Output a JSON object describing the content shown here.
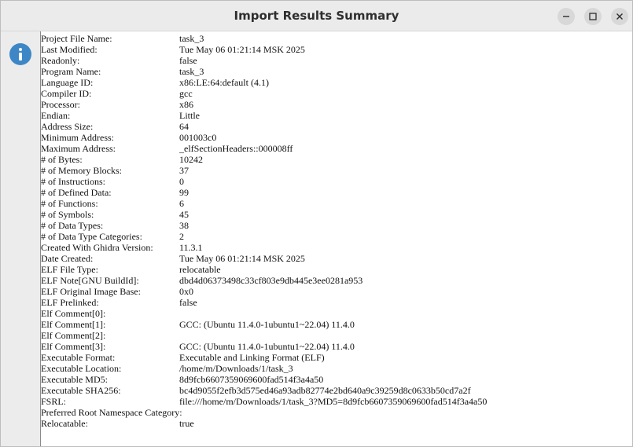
{
  "window": {
    "title": "Import Results Summary"
  },
  "icons": {
    "info": "info-icon",
    "minimize": "minimize-icon",
    "maximize": "maximize-icon",
    "close": "close-icon"
  },
  "rows": [
    {
      "label": "Project File Name:",
      "value": "task_3"
    },
    {
      "label": "Last Modified:",
      "value": "Tue May 06 01:21:14 MSK 2025"
    },
    {
      "label": "Readonly:",
      "value": "false"
    },
    {
      "label": "Program Name:",
      "value": "task_3"
    },
    {
      "label": "Language ID:",
      "value": "x86:LE:64:default (4.1)"
    },
    {
      "label": "Compiler ID:",
      "value": "gcc"
    },
    {
      "label": "Processor:",
      "value": "x86"
    },
    {
      "label": "Endian:",
      "value": "Little"
    },
    {
      "label": "Address Size:",
      "value": "64"
    },
    {
      "label": "Minimum Address:",
      "value": "001003c0"
    },
    {
      "label": "Maximum Address:",
      "value": "_elfSectionHeaders::000008ff"
    },
    {
      "label": "# of Bytes:",
      "value": "10242"
    },
    {
      "label": "# of Memory Blocks:",
      "value": "37"
    },
    {
      "label": "# of Instructions:",
      "value": "0"
    },
    {
      "label": "# of Defined Data:",
      "value": "99"
    },
    {
      "label": "# of Functions:",
      "value": "6"
    },
    {
      "label": "# of Symbols:",
      "value": "45"
    },
    {
      "label": "# of Data Types:",
      "value": "38"
    },
    {
      "label": "# of Data Type Categories:",
      "value": "2"
    },
    {
      "label": "Created With Ghidra Version:",
      "value": "11.3.1"
    },
    {
      "label": "Date Created:",
      "value": "Tue May 06 01:21:14 MSK 2025"
    },
    {
      "label": "ELF File Type:",
      "value": "relocatable"
    },
    {
      "label": "ELF Note[GNU BuildId]:",
      "value": "dbd4d06373498c33cf803e9db445e3ee0281a953"
    },
    {
      "label": "ELF Original Image Base:",
      "value": "0x0"
    },
    {
      "label": "ELF Prelinked:",
      "value": "false"
    },
    {
      "label": "Elf Comment[0]:",
      "value": ""
    },
    {
      "label": "Elf Comment[1]:",
      "value": "GCC: (Ubuntu 11.4.0-1ubuntu1~22.04) 11.4.0"
    },
    {
      "label": "Elf Comment[2]:",
      "value": ""
    },
    {
      "label": "Elf Comment[3]:",
      "value": "GCC: (Ubuntu 11.4.0-1ubuntu1~22.04) 11.4.0"
    },
    {
      "label": "Executable Format:",
      "value": "Executable and Linking Format (ELF)"
    },
    {
      "label": "Executable Location:",
      "value": "/home/m/Downloads/1/task_3"
    },
    {
      "label": "Executable MD5:",
      "value": "8d9fcb6607359069600fad514f3a4a50"
    },
    {
      "label": "Executable SHA256:",
      "value": "bc4d9055f2efb3d575ed46a93adb82774e2bd640a9c39259d8c0633b50cd7a2f"
    },
    {
      "label": "FSRL:",
      "value": "file:///home/m/Downloads/1/task_3?MD5=8d9fcb6607359069600fad514f3a4a50"
    },
    {
      "label": "Preferred Root Namespace Category:",
      "value": ""
    },
    {
      "label": "Relocatable:",
      "value": "true"
    }
  ]
}
